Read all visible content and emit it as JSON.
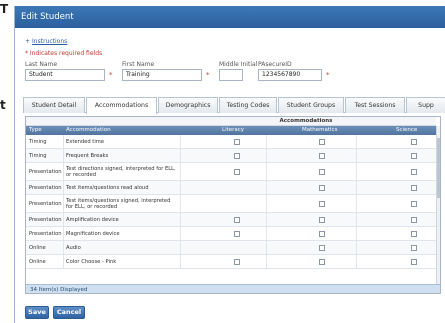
{
  "window": {
    "title": "Edit Student"
  },
  "left_fragments": [
    "T",
    "t"
  ],
  "instructions": {
    "icon": "plus-icon",
    "link_label": "Instructions"
  },
  "required_note": "* Indicates required fields",
  "fields": {
    "last_name": {
      "label": "Last Name",
      "value": "Student"
    },
    "first_name": {
      "label": "First Name",
      "value": "Training"
    },
    "middle_initial": {
      "label": "Middle Initial",
      "value": ""
    },
    "pasecure_id": {
      "label": "PAsecureID",
      "value": "1234567890"
    },
    "required_marker": "*"
  },
  "tabs": [
    {
      "label": "Student Detail",
      "active": false
    },
    {
      "label": "Accommodations",
      "active": true
    },
    {
      "label": "Demographics",
      "active": false
    },
    {
      "label": "Testing Codes",
      "active": false
    },
    {
      "label": "Student Groups",
      "active": false
    },
    {
      "label": "Test Sessions",
      "active": false
    },
    {
      "label": "Supp",
      "active": false
    }
  ],
  "grid": {
    "group_header": "Accommodations",
    "columns": [
      "Type",
      "Accommodation",
      "Literacy",
      "Mathematics",
      "Science"
    ],
    "rows": [
      {
        "type": "Timing",
        "accommodation": "Extended time",
        "checks": [
          true,
          true,
          true
        ]
      },
      {
        "type": "Timing",
        "accommodation": "Frequent Breaks",
        "checks": [
          true,
          true,
          true
        ]
      },
      {
        "type": "Presentation",
        "accommodation": "Test directions signed, interpreted for ELL, or recorded",
        "checks": [
          true,
          true,
          true
        ]
      },
      {
        "type": "Presentation",
        "accommodation": "Test items/questions read aloud",
        "checks": [
          false,
          true,
          true
        ]
      },
      {
        "type": "Presentation",
        "accommodation": "Test items/questions signed, interpreted for ELL, or recorded",
        "checks": [
          false,
          true,
          true
        ]
      },
      {
        "type": "Presentation",
        "accommodation": "Amplification device",
        "checks": [
          true,
          true,
          true
        ]
      },
      {
        "type": "Presentation",
        "accommodation": "Magnification device",
        "checks": [
          true,
          true,
          true
        ]
      },
      {
        "type": "Online",
        "accommodation": "Audio",
        "checks": [
          false,
          true,
          true
        ]
      },
      {
        "type": "Online",
        "accommodation": "Color Choose - Pink",
        "checks": [
          true,
          true,
          true
        ]
      }
    ],
    "footer": "34 Item(s) Displayed"
  },
  "buttons": {
    "save": "Save",
    "cancel": "Cancel"
  },
  "colors": {
    "titlebar": "#2a5f9c",
    "header": "#50749f",
    "link": "#2b5fa3",
    "required": "#c0392b",
    "footer": "#cfe0f1"
  }
}
